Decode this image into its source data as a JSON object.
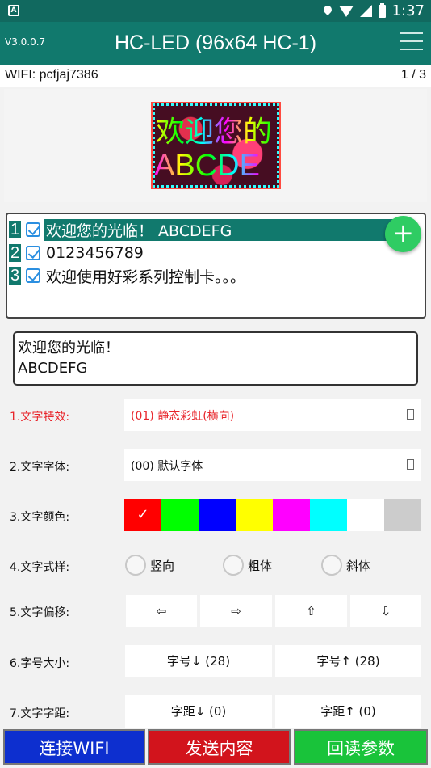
{
  "status_bar": {
    "app_badge": "A",
    "time": "1:37"
  },
  "app_bar": {
    "version": "V3.0.0.7",
    "title": "HC-LED (96x64 HC-1)"
  },
  "wifi": {
    "label": "WIFI: pcfjaj7386",
    "page": "1 / 3"
  },
  "preview": {
    "line1": "欢迎您的",
    "line2": "ABCDE"
  },
  "program_list": [
    {
      "index": "1",
      "text": "欢迎您的光临！ ABCDEFG",
      "checked": true,
      "selected": true
    },
    {
      "index": "2",
      "text": "0123456789",
      "checked": true,
      "selected": false
    },
    {
      "index": "3",
      "text": "欢迎使用好彩系列控制卡。。。",
      "checked": true,
      "selected": false
    }
  ],
  "fab_label": "+",
  "editor_text": "欢迎您的光临！\nABCDEFG",
  "settings": {
    "effect": {
      "label": "1.文字特效:",
      "value": "(01) 静态彩虹(横向)"
    },
    "font": {
      "label": "2.文字字体:",
      "value": "(00) 默认字体"
    },
    "color": {
      "label": "3.文字颜色:",
      "swatches": [
        "#ff0000",
        "#00ff00",
        "#0000ff",
        "#ffff00",
        "#ff00ff",
        "#00ffff",
        "#ffffff",
        "#cccccc"
      ],
      "selected_mark": "✓"
    },
    "style": {
      "label": "4.文字式样:",
      "options": [
        "竖向",
        "粗体",
        "斜体"
      ]
    },
    "offset": {
      "label": "5.文字偏移:",
      "arrows": [
        "⇦",
        "⇨",
        "⇧",
        "⇩"
      ]
    },
    "size": {
      "label": "6.字号大小:",
      "down": "字号↓ (28)",
      "up": "字号↑ (28)"
    },
    "spacing": {
      "label": "7.文字字距:",
      "down": "字距↓ (0)",
      "up": "字距↑ (0)"
    }
  },
  "bottom_buttons": {
    "connect": "连接WIFI",
    "send": "发送内容",
    "read": "回读参数"
  },
  "colors": {
    "accent": "#11796d",
    "status": "#11695f",
    "connect": "#0d2fcf",
    "send": "#d2141c",
    "read": "#19c33a"
  }
}
